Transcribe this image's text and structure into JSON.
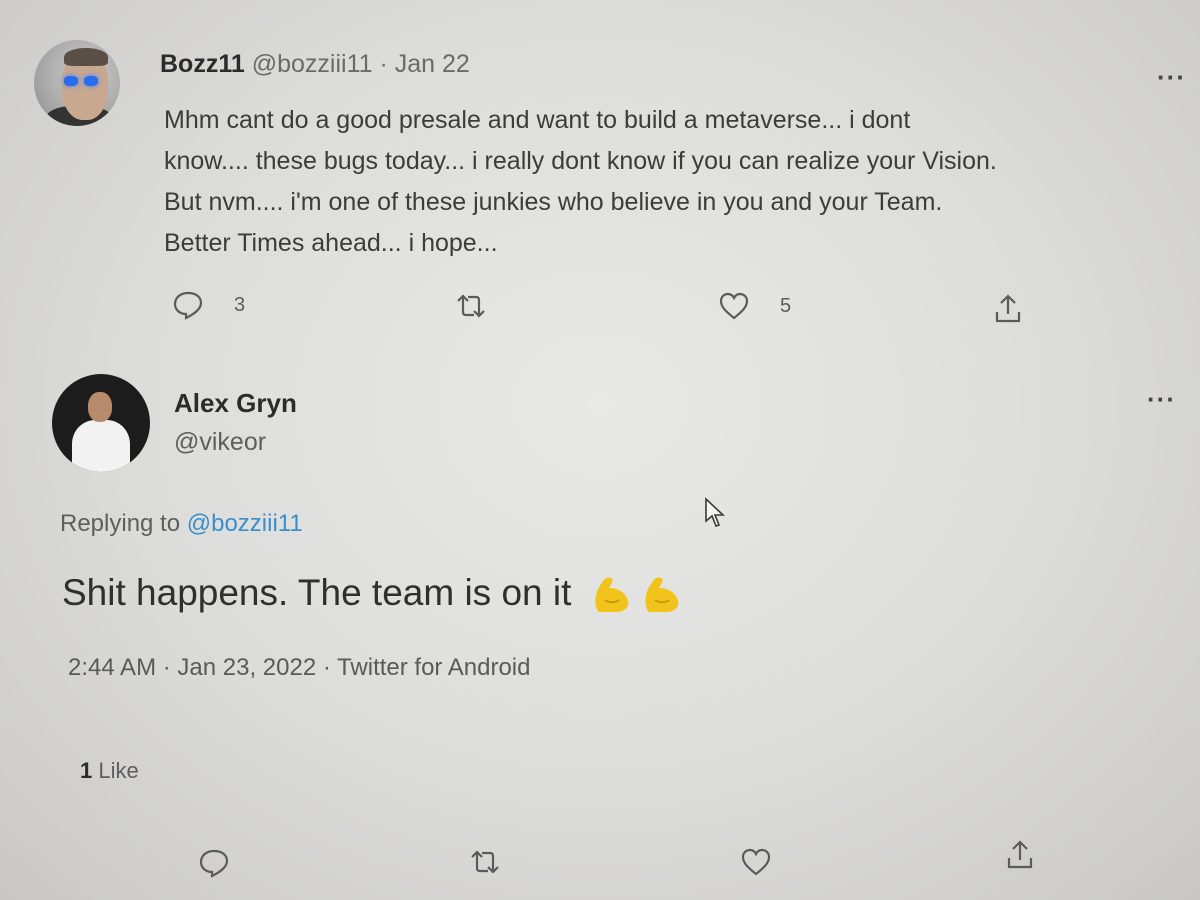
{
  "tweet1": {
    "display_name": "Bozz11",
    "handle": "@bozziii11",
    "separator": " · ",
    "date": "Jan 22",
    "lines": [
      "Mhm cant do a good presale and want to build a metaverse... i dont",
      "know.... these bugs today... i really dont know if you can realize your Vision.",
      "But nvm.... i'm one of these junkies who believe in you and your Team.",
      "Better Times ahead... i hope..."
    ],
    "more_label": "···",
    "reply_count": "3",
    "like_count": "5"
  },
  "tweet2": {
    "display_name": "Alex Gryn",
    "handle": "@vikeor",
    "more_label": "···",
    "replying_prefix": "Replying to ",
    "replying_mention": "@bozziii11",
    "text": "Shit happens. The team is on it",
    "meta": "2:44 AM · Jan 23, 2022 · Twitter for Android",
    "likes_count": "1",
    "likes_label": " Like"
  },
  "icons": {
    "reply": "speech-bubble-icon",
    "retweet": "retweet-arrows-icon",
    "like": "heart-icon",
    "share": "share-upload-icon",
    "emoji": "flexed-biceps-emoji"
  },
  "colors": {
    "mention": "#3a8ecb",
    "emoji": "#f2c31a"
  }
}
